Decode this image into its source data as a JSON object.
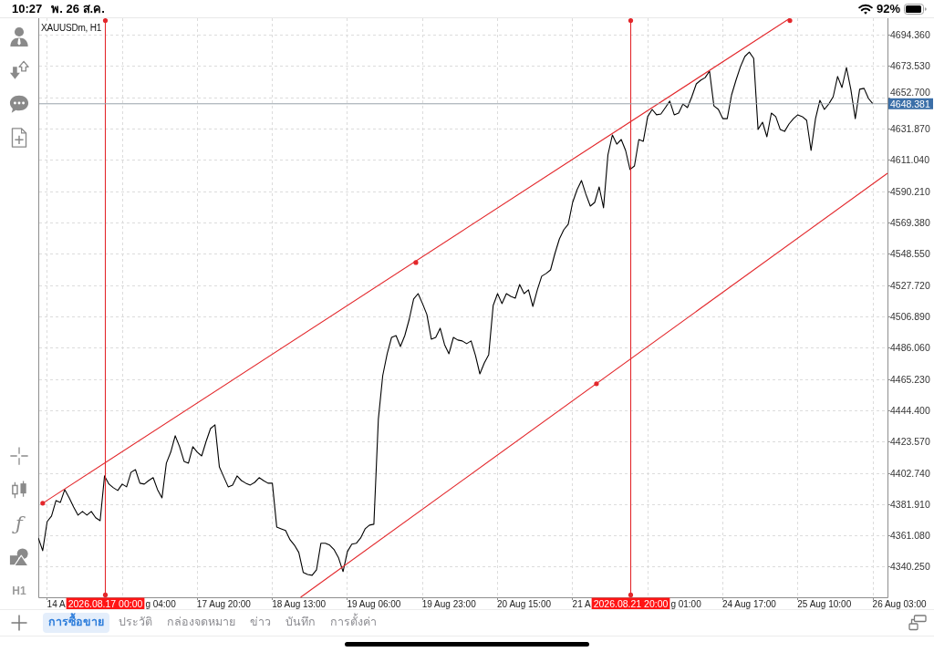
{
  "status_bar": {
    "time": "10:27",
    "date": "พ. 26 ส.ค.",
    "battery": "92%"
  },
  "left_toolbar": {
    "indicator_glyph": "ƒ",
    "timeframe": "H1"
  },
  "chart": {
    "chart_data": {
      "type": "line",
      "title": "XAUUSDm, H1",
      "grid": true,
      "categories": [
        null,
        null,
        null,
        null,
        null,
        null,
        null,
        null,
        null,
        null,
        null,
        null,
        null,
        null,
        null,
        null,
        null,
        null,
        null,
        null,
        null,
        null,
        null,
        null,
        null,
        null,
        null,
        null,
        null,
        null,
        null,
        null,
        null,
        null,
        null,
        null,
        null,
        null,
        null,
        null,
        null,
        null,
        "17 Aug 20:00",
        null,
        null,
        null,
        null,
        null,
        null,
        null,
        null,
        null,
        null,
        null,
        null,
        null,
        null,
        null,
        null,
        "18 Aug 13:00",
        null,
        null,
        null,
        null,
        null,
        null,
        null,
        null,
        null,
        null,
        null,
        null,
        null,
        null,
        null,
        null,
        "19 Aug 06:00",
        null,
        null,
        null,
        null,
        null,
        null,
        null,
        null,
        null,
        null,
        null,
        null,
        null,
        null,
        null,
        null,
        "19 Aug 23:00",
        null,
        null,
        null,
        null,
        null,
        null,
        null,
        null,
        null,
        null,
        null,
        null,
        null,
        null,
        null,
        null,
        "20 Aug 15:00",
        null,
        null,
        null,
        null,
        null,
        null,
        null,
        null,
        null,
        null,
        null,
        null,
        null,
        null,
        null,
        null,
        null,
        null,
        null,
        null,
        null,
        null,
        null,
        null,
        null,
        null,
        null,
        null,
        null,
        null,
        null,
        null,
        null,
        null,
        null,
        null,
        null,
        null,
        null,
        null,
        null,
        null,
        null,
        null,
        null,
        null,
        null,
        null,
        null,
        null,
        "24 Aug 17:00",
        null,
        null,
        null,
        null,
        null,
        null,
        null,
        null,
        null,
        null,
        null,
        null,
        null,
        null,
        null,
        null,
        "25 Aug 10:00",
        null,
        null,
        null,
        null,
        null,
        null,
        null,
        null,
        null,
        null,
        null,
        null,
        null,
        null,
        null,
        null,
        "26 Aug 03:00"
      ],
      "series": [
        {
          "color": "#000000",
          "values": [
            4359.4,
            4350.9,
            4370.3,
            4374.0,
            4384.3,
            4383.1,
            4391.6,
            4386.1,
            4380.0,
            4374.6,
            4377.0,
            4374.6,
            4377.0,
            4372.8,
            4370.9,
            4400.7,
            4395.2,
            4392.8,
            4391.0,
            4395.2,
            4393.4,
            4403.1,
            4404.9,
            4395.8,
            4395.2,
            4397.6,
            4399.5,
            4391.6,
            4386.1,
            4409.2,
            4416.5,
            4427.4,
            4420.1,
            4410.4,
            4409.2,
            4420.1,
            4416.5,
            4414.0,
            4423.7,
            4432.2,
            4434.7,
            4406.7,
            4400.1,
            4393.4,
            4394.6,
            4400.7,
            4397.6,
            4395.8,
            4394.6,
            4396.4,
            4399.5,
            4397.6,
            4395.8,
            4395.8,
            4366.7,
            4365.5,
            4364.3,
            4358.2,
            4354.6,
            4349.7,
            4336.4,
            4335.1,
            4334.5,
            4338.2,
            4355.8,
            4355.8,
            4354.6,
            4351.5,
            4346.1,
            4337.0,
            4350.3,
            4355.2,
            4355.8,
            4359.4,
            4365.5,
            4367.9,
            4368.5,
            4438.3,
            4467.4,
            4482.0,
            4492.9,
            4494.1,
            4486.8,
            4494.1,
            4505.0,
            4518.4,
            4522.0,
            4515.4,
            4508.1,
            4491.7,
            4492.9,
            4499.0,
            4488.1,
            4482.0,
            4492.9,
            4491.1,
            4490.5,
            4488.7,
            4490.5,
            4480.8,
            4468.6,
            4475.9,
            4481.4,
            4514.1,
            4522.0,
            4515.4,
            4522.0,
            4520.2,
            4519.0,
            4528.1,
            4522.0,
            4524.5,
            4513.5,
            4524.5,
            4533.6,
            4535.4,
            4537.8,
            4548.7,
            4558.4,
            4564.5,
            4568.2,
            4582.7,
            4591.2,
            4597.3,
            4588.2,
            4580.3,
            4582.7,
            4593.0,
            4579.1,
            4614.3,
            4627.6,
            4621.5,
            4624.6,
            4617.3,
            4604.6,
            4607.0,
            4624.6,
            4623.4,
            4639.8,
            4644.6,
            4641.0,
            4641.6,
            4645.8,
            4650.1,
            4641.0,
            4642.2,
            4648.2,
            4645.8,
            4653.1,
            4661.6,
            4664.0,
            4665.8,
            4670.1,
            4647.0,
            4644.6,
            4638.5,
            4638.5,
            4654.3,
            4664.0,
            4673.1,
            4679.8,
            4682.8,
            4678.6,
            4631.3,
            4636.1,
            4626.4,
            4642.2,
            4639.8,
            4631.3,
            4630.0,
            4634.9,
            4638.5,
            4641.0,
            4639.8,
            4637.3,
            4617.3,
            4638.5,
            4650.7,
            4644.6,
            4648.2,
            4653.1,
            4666.5,
            4659.2,
            4672.5,
            4658.0,
            4638.5,
            4658.0,
            4658.6,
            4651.9,
            4648.4,
            null,
            null,
            null,
            null,
            null,
            null
          ]
        }
      ],
      "ylim": [
        4319.9,
        4705.3
      ],
      "yticks": [
        {
          "value": 4694.36,
          "label": "4694.360"
        },
        {
          "value": 4673.53,
          "label": "4673.530"
        },
        {
          "value": 4652.7,
          "label": "4652.700"
        },
        {
          "value": 4631.87,
          "label": "4631.870"
        },
        {
          "value": 4611.04,
          "label": "4611.040"
        },
        {
          "value": 4590.21,
          "label": "4590.210"
        },
        {
          "value": 4569.38,
          "label": "4569.380"
        },
        {
          "value": 4548.55,
          "label": "4548.550"
        },
        {
          "value": 4527.72,
          "label": "4527.720"
        },
        {
          "value": 4506.89,
          "label": "4506.890"
        },
        {
          "value": 4486.06,
          "label": "4486.060"
        },
        {
          "value": 4465.23,
          "label": "4465.230"
        },
        {
          "value": 4444.4,
          "label": "4444.400"
        },
        {
          "value": 4423.57,
          "label": "4423.570"
        },
        {
          "value": 4402.74,
          "label": "4402.740"
        },
        {
          "value": 4381.91,
          "label": "4381.910"
        },
        {
          "value": 4361.08,
          "label": "4361.080"
        },
        {
          "value": 4340.25,
          "label": "4340.250"
        }
      ]
    },
    "objects": [
      {
        "kind": "trendline"
      },
      {
        "kind": "trendline"
      },
      {
        "kind": "vline",
        "label": "2026.08.17 00:00",
        "covered_ticks": [
          "14 A",
          "g 04:00"
        ]
      },
      {
        "kind": "vline",
        "label": "2026.08.21 20:00",
        "covered_ticks": [
          "21 A",
          "g 01:00"
        ]
      },
      {
        "kind": "hline",
        "label": "4648.381"
      },
      {
        "kind": "handle"
      },
      {
        "kind": "handle"
      },
      {
        "kind": "handle"
      },
      {
        "kind": "handle"
      }
    ]
  },
  "tabs": [
    {
      "label": "การซื้อขาย",
      "selected": true
    },
    {
      "label": "ประวัติ",
      "selected": false
    },
    {
      "label": "กล่องจดหมาย",
      "selected": false
    },
    {
      "label": "ข่าว",
      "selected": false
    },
    {
      "label": "บันทึก",
      "selected": false
    },
    {
      "label": "การตั้งค่า",
      "selected": false
    }
  ]
}
